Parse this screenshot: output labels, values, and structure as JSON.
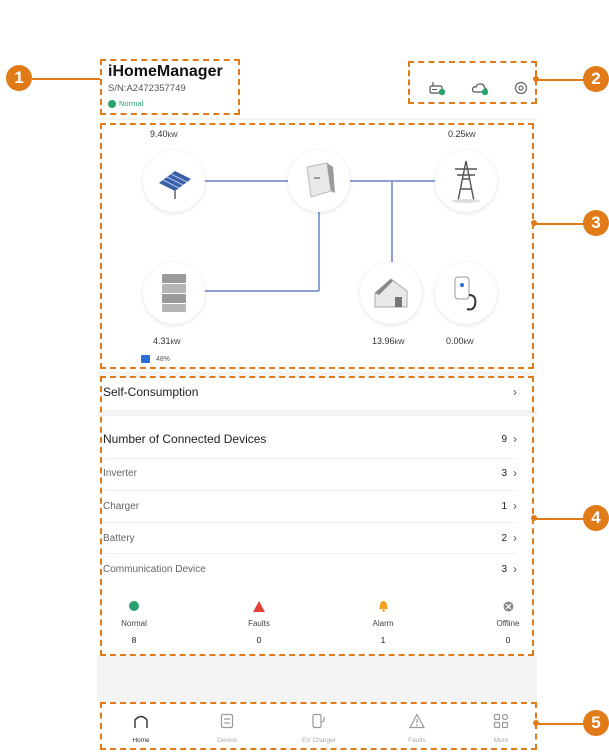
{
  "app": {
    "title": "iHomeManager",
    "serial": "S/N:A2472357749",
    "status": "Normal"
  },
  "header_icons": [
    "router-status-icon",
    "cloud-status-icon",
    "settings-icon"
  ],
  "power_flow": {
    "pv_power": "9.40",
    "grid_power": "0.25",
    "battery_power": "4.31",
    "battery_soc": "48%",
    "load_power": "13.96",
    "charger_power": "0.00",
    "unit": "kW"
  },
  "self_consumption": {
    "label": "Self-Consumption"
  },
  "devices": {
    "header_label": "Number of Connected Devices",
    "header_count": "9",
    "items": [
      {
        "label": "Inverter",
        "count": "3"
      },
      {
        "label": "Charger",
        "count": "1"
      },
      {
        "label": "Battery",
        "count": "2"
      },
      {
        "label": "Communication Device",
        "count": "3"
      }
    ]
  },
  "status_summary": [
    {
      "label": "Normal",
      "count": "8",
      "color": "#27a36b"
    },
    {
      "label": "Faults",
      "count": "0",
      "color": "#e0413b"
    },
    {
      "label": "Alarm",
      "count": "1",
      "color": "#f2a31b"
    },
    {
      "label": "Offline",
      "count": "0",
      "color": "#8a8a8a"
    }
  ],
  "bottom_nav": [
    {
      "label": "Home",
      "icon": "home-icon",
      "active": true
    },
    {
      "label": "Device",
      "icon": "device-icon",
      "active": false
    },
    {
      "label": "EV Charger",
      "icon": "ev-charger-icon",
      "active": false
    },
    {
      "label": "Faults",
      "icon": "faults-icon",
      "active": false
    },
    {
      "label": "More",
      "icon": "more-icon",
      "active": false
    }
  ],
  "callouts": [
    "1",
    "2",
    "3",
    "4",
    "5"
  ],
  "colors": {
    "accent": "#e07b17",
    "normal": "#27a36b",
    "flow_line": "#8fa0d6"
  }
}
